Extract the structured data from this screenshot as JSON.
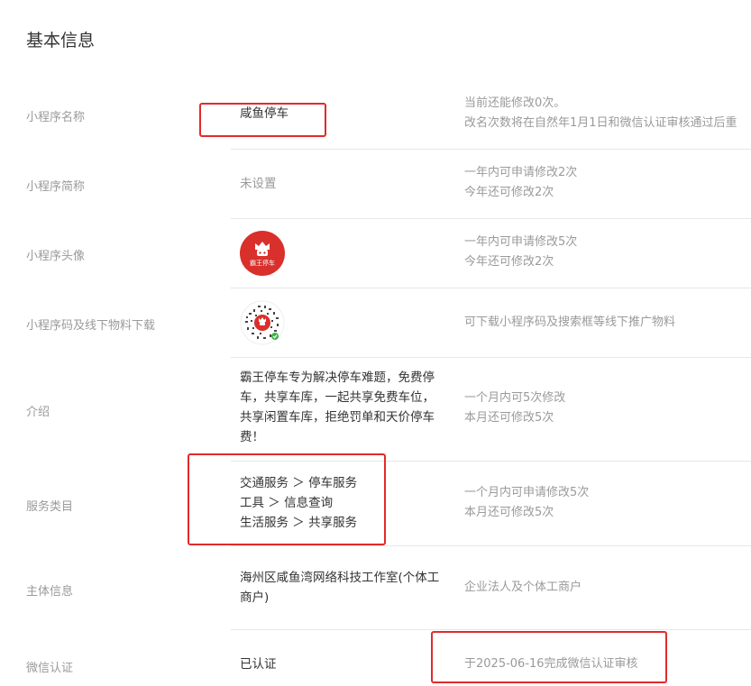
{
  "page_title": "基本信息",
  "rows": {
    "name": {
      "label": "小程序名称",
      "value": "咸鱼停车",
      "hints": [
        "当前还能修改0次。",
        "改名次数将在自然年1月1日和微信认证审核通过后重"
      ]
    },
    "short_name": {
      "label": "小程序简称",
      "value": "未设置",
      "hints": [
        "一年内可申请修改2次",
        "今年还可修改2次"
      ]
    },
    "avatar": {
      "label": "小程序头像",
      "logo_text": "霸王停车",
      "icon": "parking-logo-icon",
      "hints": [
        "一年内可申请修改5次",
        "今年还可修改2次"
      ]
    },
    "qrcode": {
      "label": "小程序码及线下物料下载",
      "icon": "qr-code-icon",
      "hints": [
        "可下载小程序码及搜索框等线下推广物料"
      ]
    },
    "intro": {
      "label": "介绍",
      "lines": [
        "霸王停车专为解决停车难题，免费停",
        "车，共享车库，一起共享免费车位，",
        "共享闲置车库，拒绝罚单和天价停车",
        "费！"
      ],
      "hints": [
        "一个月内可5次修改",
        "本月还可修改5次"
      ]
    },
    "category": {
      "label": "服务类目",
      "lines": [
        "交通服务 ＞ 停车服务",
        "工具 ＞ 信息查询",
        "生活服务 ＞ 共享服务"
      ],
      "hints": [
        "一个月内可申请修改5次",
        "本月还可修改5次"
      ]
    },
    "subject": {
      "label": "主体信息",
      "lines": [
        "海州区咸鱼湾网络科技工作室(个体工",
        "商户)"
      ],
      "hints": [
        "企业法人及个体工商户"
      ]
    },
    "wechat_verify": {
      "label": "微信认证",
      "value": "已认证",
      "hints": [
        "于2025-06-16完成微信认证审核"
      ]
    }
  },
  "colors": {
    "highlight": "#e22a2a",
    "logo_red": "#d9302b"
  }
}
